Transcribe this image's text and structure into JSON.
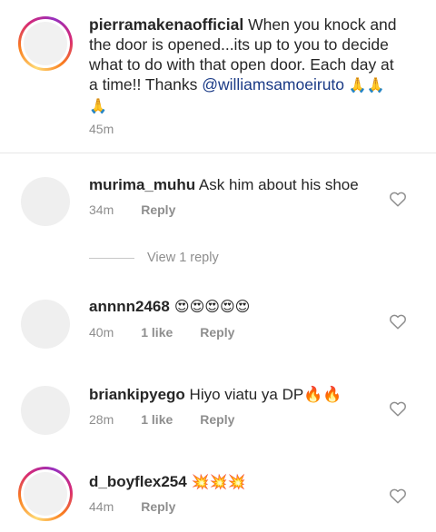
{
  "caption": {
    "username": "pierramakenaofficial",
    "text": " When you knock and the door is opened...its up to you to decide what to do with that open door. Each day at a time!! Thanks ",
    "mention": "@williamsamoeiruto",
    "emojis": "🙏🙏🙏",
    "time": "45m"
  },
  "comments": [
    {
      "username": "murima_muhu",
      "text": " Ask him about his shoe",
      "time": "34m",
      "likes": "",
      "reply_label": "Reply"
    },
    {
      "username": "annnn2468",
      "text": " 😍😍😍😍😍",
      "time": "40m",
      "likes": "1 like",
      "reply_label": "Reply"
    },
    {
      "username": "briankipyego",
      "text": " Hiyo viatu ya DP🔥🔥",
      "time": "28m",
      "likes": "1 like",
      "reply_label": "Reply"
    },
    {
      "username": "d_boyflex254",
      "text": " 💥💥💥",
      "time": "44m",
      "likes": "",
      "reply_label": "Reply"
    }
  ],
  "view_replies": "View 1 reply",
  "colors": {
    "text": "#262626",
    "secondary": "#8e8e8e",
    "mention": "#1a3a86"
  }
}
